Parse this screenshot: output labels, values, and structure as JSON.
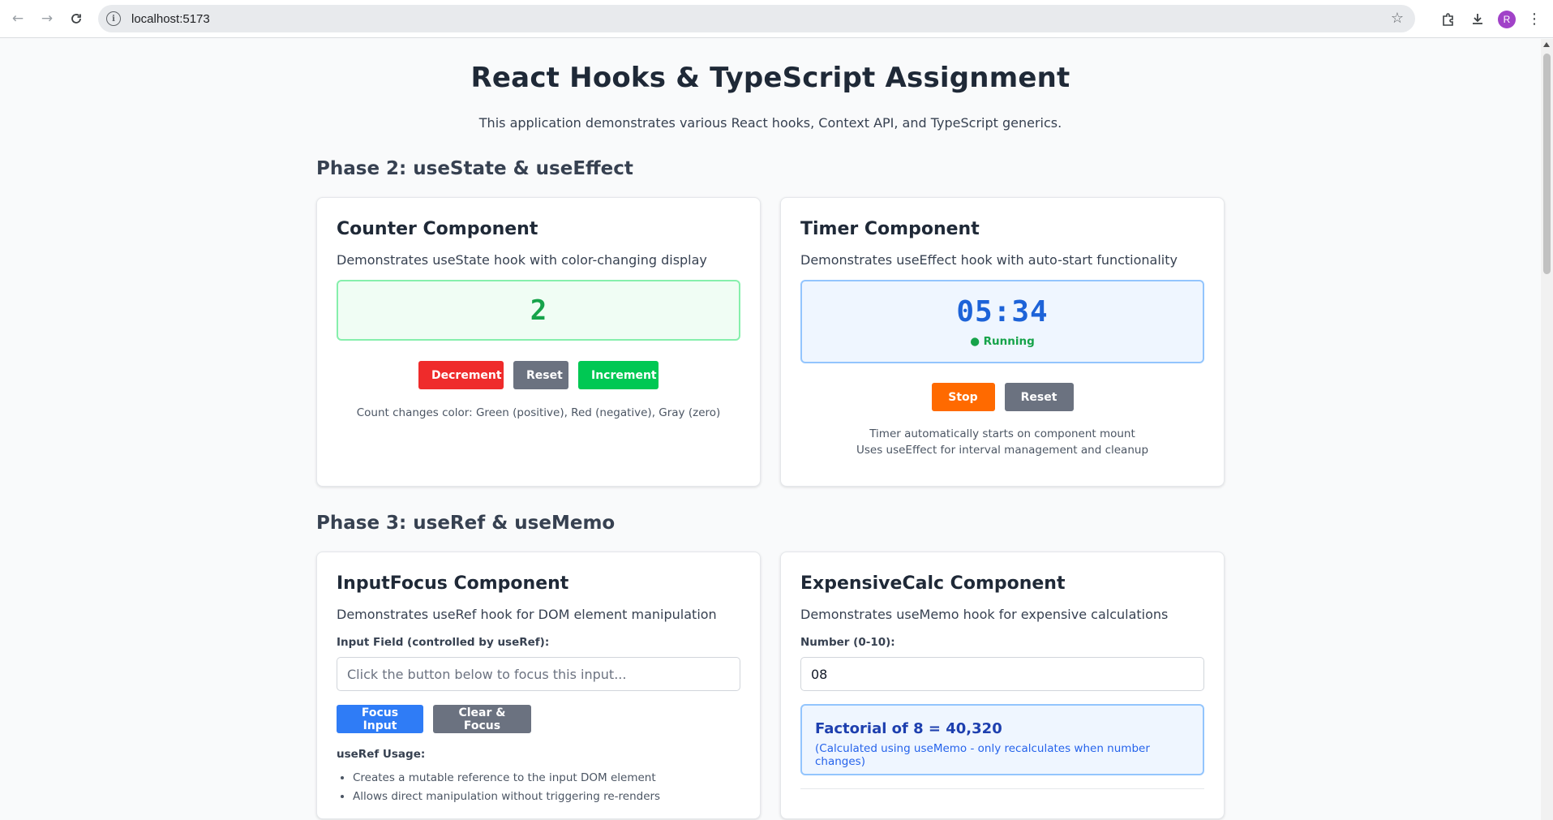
{
  "browser": {
    "url": "localhost:5173",
    "avatar_letter": "R"
  },
  "header": {
    "title": "React Hooks & TypeScript Assignment",
    "subtitle": "This application demonstrates various React hooks, Context API, and TypeScript generics."
  },
  "phase2": {
    "heading": "Phase 2: useState & useEffect",
    "counter": {
      "title": "Counter Component",
      "description": "Demonstrates useState hook with color-changing display",
      "value": "2",
      "decrement_label": "Decrement",
      "reset_label": "Reset",
      "increment_label": "Increment",
      "note": "Count changes color: Green (positive), Red (negative), Gray (zero)",
      "value_color": "#16a34a"
    },
    "timer": {
      "title": "Timer Component",
      "description": "Demonstrates useEffect hook with auto-start functionality",
      "time": "05:34",
      "status": "● Running",
      "stop_label": "Stop",
      "reset_label": "Reset",
      "note_line1": "Timer automatically starts on component mount",
      "note_line2": "Uses useEffect for interval management and cleanup"
    }
  },
  "phase3": {
    "heading": "Phase 3: useRef & useMemo",
    "input_focus": {
      "title": "InputFocus Component",
      "description": "Demonstrates useRef hook for DOM element manipulation",
      "field_label": "Input Field (controlled by useRef):",
      "placeholder": "Click the button below to focus this input...",
      "focus_label": "Focus Input",
      "clear_label": "Clear & Focus",
      "usage_title": "useRef Usage:",
      "usage_items": [
        "Creates a mutable reference to the input DOM element",
        "Allows direct manipulation without triggering re-renders"
      ]
    },
    "expensive_calc": {
      "title": "ExpensiveCalc Component",
      "description": "Demonstrates useMemo hook for expensive calculations",
      "field_label": "Number (0-10):",
      "value": "08",
      "result": "Factorial of 8 = 40,320",
      "result_note": "(Calculated using useMemo - only recalculates when number changes)"
    }
  },
  "colors": {
    "decrement": "#ef2b2b",
    "reset": "#6b7280",
    "increment": "#00c853",
    "stop": "#ff6a00",
    "focus": "#2f7cf6"
  }
}
